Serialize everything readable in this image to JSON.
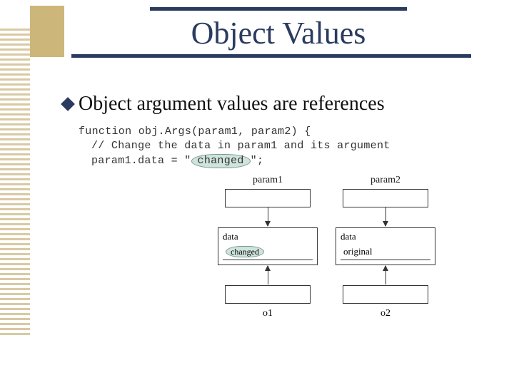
{
  "title": "Object Values",
  "bullet": "Object argument values are references",
  "code": {
    "line1_pre": "function obj.Args(param1, param2) {",
    "line2": "// Change the data in param1 and its argument",
    "line3_pre": "param1.data = \"",
    "line3_hl": "changed",
    "line3_post": "\";"
  },
  "diagram": {
    "col1": {
      "top_label": "param1",
      "field_label": "data",
      "field_value": "changed",
      "bottom_label": "o1"
    },
    "col2": {
      "top_label": "param2",
      "field_label": "data",
      "field_value": "original",
      "bottom_label": "o2"
    }
  }
}
